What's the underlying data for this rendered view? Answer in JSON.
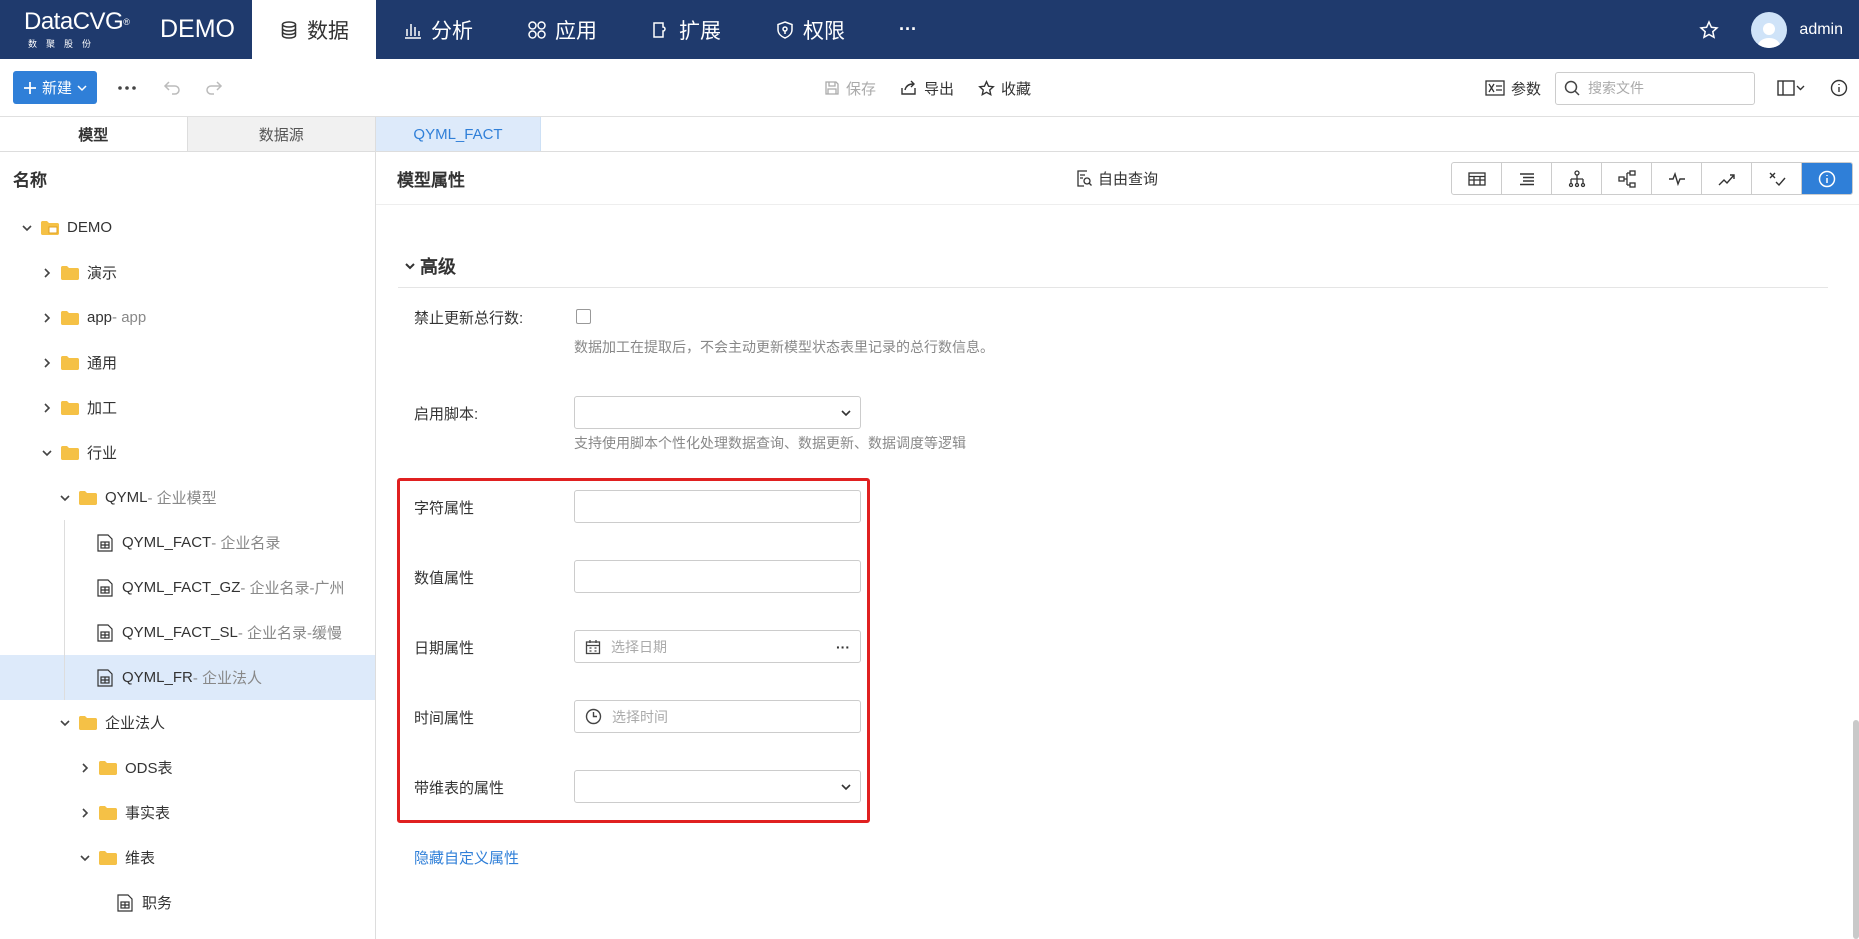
{
  "brand": {
    "logo": "DataCVG",
    "logo_mark": "®",
    "logo_sub": "数聚股份",
    "app_name": "DEMO"
  },
  "nav": {
    "items": [
      {
        "label": "数据",
        "icon": "database-icon",
        "active": true
      },
      {
        "label": "分析",
        "icon": "bar-chart-icon",
        "active": false
      },
      {
        "label": "应用",
        "icon": "apps-icon",
        "active": false
      },
      {
        "label": "扩展",
        "icon": "extension-icon",
        "active": false
      },
      {
        "label": "权限",
        "icon": "shield-icon",
        "active": false
      }
    ],
    "more": "···",
    "user": "admin"
  },
  "toolbar": {
    "new_label": "新建",
    "save_label": "保存",
    "export_label": "导出",
    "favorite_label": "收藏",
    "params_label": "参数",
    "search_placeholder": "搜索文件"
  },
  "left": {
    "tabs": [
      "模型",
      "数据源"
    ],
    "header": "名称",
    "tree": [
      {
        "label": "DEMO",
        "desc": ""
      },
      {
        "label": "演示",
        "desc": ""
      },
      {
        "label": "app",
        "desc": " - app"
      },
      {
        "label": "通用",
        "desc": ""
      },
      {
        "label": "加工",
        "desc": ""
      },
      {
        "label": "行业",
        "desc": ""
      },
      {
        "label": "QYML",
        "desc": " - 企业模型"
      },
      {
        "label": "QYML_FACT",
        "desc": " - 企业名录"
      },
      {
        "label": "QYML_FACT_GZ",
        "desc": " - 企业名录-广州"
      },
      {
        "label": "QYML_FACT_SL",
        "desc": " - 企业名录-缓慢"
      },
      {
        "label": "QYML_FR",
        "desc": " - 企业法人"
      },
      {
        "label": "企业法人",
        "desc": ""
      },
      {
        "label": "ODS表",
        "desc": ""
      },
      {
        "label": "事实表",
        "desc": ""
      },
      {
        "label": "维表",
        "desc": ""
      },
      {
        "label": "职务",
        "desc": ""
      }
    ]
  },
  "main": {
    "doc_tab": "QYML_FACT",
    "model_title": "模型属性",
    "free_query": "自由查询",
    "section_title": "高级",
    "fields": {
      "disable_update": {
        "label": "禁止更新总行数:",
        "hint": "数据加工在提取后，不会主动更新模型状态表里记录的总行数信息。"
      },
      "script": {
        "label": "启用脚本:",
        "hint": "支持使用脚本个性化处理数据查询、数据更新、数据调度等逻辑"
      },
      "string_attr": {
        "label": "字符属性"
      },
      "number_attr": {
        "label": "数值属性"
      },
      "date_attr": {
        "label": "日期属性",
        "placeholder": "选择日期",
        "more": "···"
      },
      "time_attr": {
        "label": "时间属性",
        "placeholder": "选择时间"
      },
      "dim_attr": {
        "label": "带维表的属性"
      }
    },
    "hide_link": "隐藏自定义属性"
  },
  "colors": {
    "nav_bg": "#1f3a6d",
    "accent": "#2f7fd8",
    "highlight": "#e02020",
    "selected_bg": "#ddeafa"
  }
}
